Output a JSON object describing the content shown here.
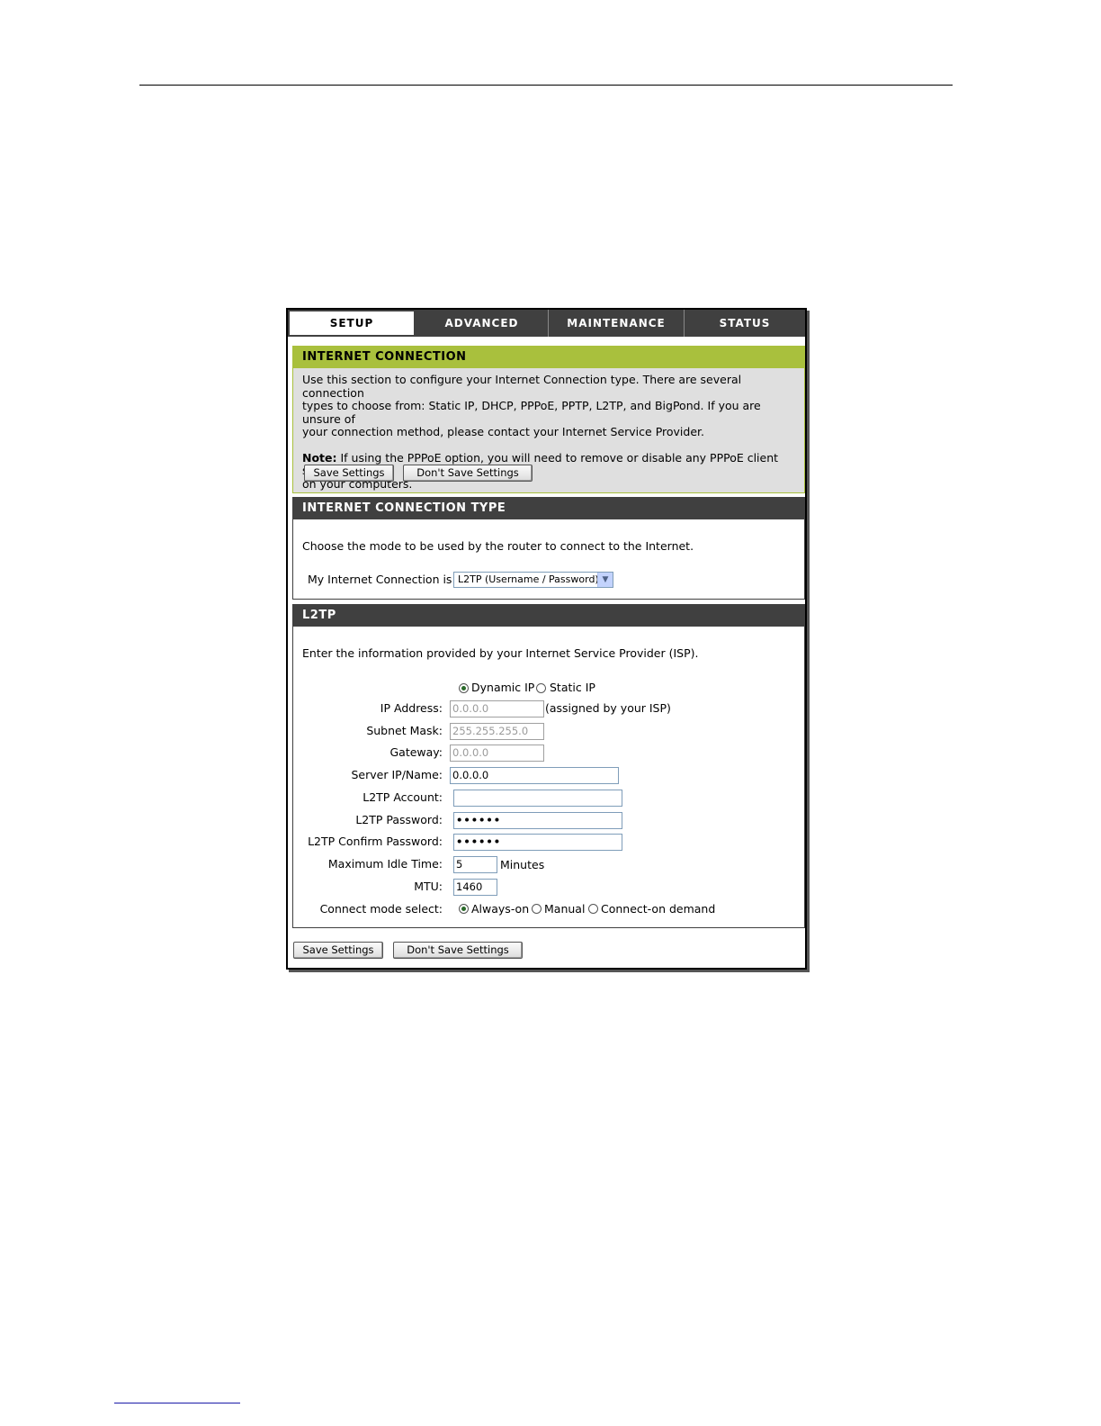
{
  "tabs": [
    {
      "label": "SETUP",
      "active": true
    },
    {
      "label": "ADVANCED",
      "active": false
    },
    {
      "label": "MAINTENANCE",
      "active": false
    },
    {
      "label": "STATUS",
      "active": false
    }
  ],
  "internet_connection": {
    "title": "INTERNET CONNECTION",
    "intro_lines": [
      "Use this section to configure your Internet Connection type. There are several connection",
      "types to choose from: Static IP, DHCP, PPPoE, PPTP, L2TP, and BigPond. If you are unsure of",
      "your connection method, please contact your Internet Service Provider."
    ],
    "note_label": "Note:",
    "note_line1": " If using the PPPoE option, you will need to remove or disable any PPPoE client software",
    "note_line2": "on your computers.",
    "save_label": "Save Settings",
    "dont_save_label": "Don't Save Settings"
  },
  "connection_type": {
    "title": "INTERNET CONNECTION TYPE",
    "description": "Choose the mode to be used by the router to connect to the Internet.",
    "select_label": "My Internet Connection is:",
    "select_value": "L2TP (Username / Password)"
  },
  "l2tp": {
    "title": "L2TP",
    "description": "Enter the information provided by your Internet Service Provider (ISP).",
    "ip_mode_options": [
      "Dynamic IP",
      "Static IP"
    ],
    "ip_mode_selected": "Dynamic IP",
    "ip_address_label": "IP Address:",
    "ip_address_value": "0.0.0.0",
    "ip_address_note": "(assigned by your ISP)",
    "subnet_label": "Subnet Mask:",
    "subnet_value": "255.255.255.0",
    "gateway_label": "Gateway:",
    "gateway_value": "0.0.0.0",
    "server_label": "Server IP/Name:",
    "server_value": "0.0.0.0",
    "account_label": "L2TP Account:",
    "account_value": "",
    "password_label": "L2TP Password:",
    "password_value": "••••••",
    "confirm_label": "L2TP Confirm Password:",
    "confirm_value": "••••••",
    "idle_label": "Maximum Idle Time:",
    "idle_value": "5",
    "idle_unit": "Minutes",
    "mtu_label": "MTU:",
    "mtu_value": "1460",
    "connect_label": "Connect mode select:",
    "connect_options": [
      "Always-on",
      "Manual",
      "Connect-on demand"
    ],
    "connect_selected": "Always-on"
  },
  "footer": {
    "save_label": "Save Settings",
    "dont_save_label": "Don't Save Settings"
  },
  "colors": {
    "header_green": "#a9c03d",
    "header_dark": "#404040",
    "panel_gray": "#dfdfdf"
  }
}
